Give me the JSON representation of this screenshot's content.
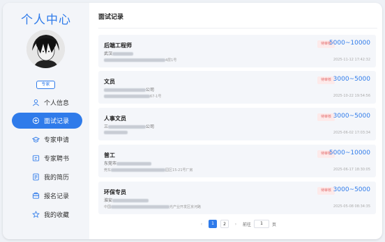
{
  "sidebar": {
    "brand": "个人中心",
    "badge": "专家",
    "items": [
      {
        "label": "个人信息",
        "icon": "user-icon"
      },
      {
        "label": "面试记录",
        "icon": "interview-icon"
      },
      {
        "label": "专家申请",
        "icon": "cap-icon"
      },
      {
        "label": "专家聘书",
        "icon": "certificate-icon"
      },
      {
        "label": "我的简历",
        "icon": "resume-icon"
      },
      {
        "label": "报名记录",
        "icon": "signup-icon"
      },
      {
        "label": "我的收藏",
        "icon": "star-icon"
      }
    ],
    "active_index": 1
  },
  "main": {
    "title": "面试记录",
    "records": [
      {
        "title": "后端工程师",
        "sub_prefix": "武汉",
        "addr_suffix": "4层1号",
        "tag": "待审核",
        "salary": "5000~10000",
        "time": "2025-11-12 17:42:32"
      },
      {
        "title": "文员",
        "sub_prefix": "",
        "sub_suffix": "公司",
        "addr_suffix": "67-1号",
        "tag": "待审核",
        "salary": "3000~5000",
        "time": "2025-10-22 19:54:56"
      },
      {
        "title": "人事文员",
        "sub_prefix": "三",
        "sub_suffix": "公司",
        "addr_suffix": "",
        "tag": "待审核",
        "salary": "3000~5000",
        "time": "2025-06-02 17:03:34"
      },
      {
        "title": "普工",
        "sub_prefix": "东莞市",
        "sub_suffix": "",
        "addr_prefix": "莞东",
        "addr_suffix": "园区15-21号厂房",
        "tag": "待审核",
        "salary": "5000~10000",
        "time": "2025-06-17 18:30:05"
      },
      {
        "title": "环保专员",
        "sub_prefix": "淮安",
        "sub_suffix": "",
        "addr_prefix": "中国",
        "addr_suffix": "光产业开发区京河路",
        "tag": "待审核",
        "salary": "3000~5000",
        "time": "2025-05-08 08:34:35"
      }
    ]
  },
  "pagination": {
    "prev": "‹",
    "pages": [
      "1",
      "2"
    ],
    "current": "1",
    "next": "›",
    "goto_label": "前往",
    "goto_value": "1",
    "page_unit": "页"
  },
  "colors": {
    "accent": "#2f7bea",
    "tag_bg": "#fdeaea",
    "tag_text": "#e36a6a"
  }
}
